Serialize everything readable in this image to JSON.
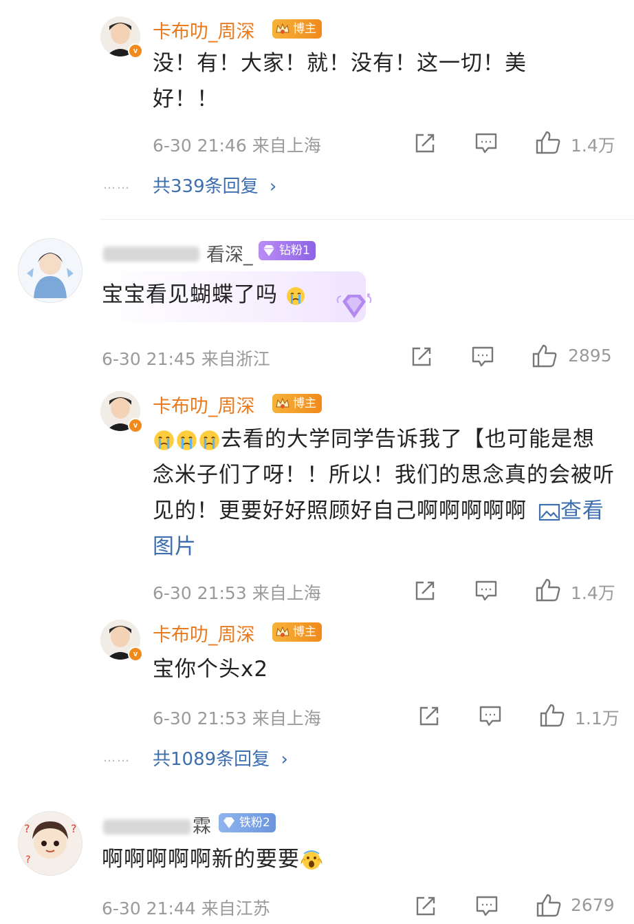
{
  "comments": [
    {
      "id": "c1",
      "username": "卡布叻_周深",
      "tag": "博主",
      "text": "没！有！大家！就！没有！这一切！美好！！",
      "time": "6-30 21:46",
      "location": "来自上海",
      "likes": "1.4万",
      "replies": "共339条回复"
    },
    {
      "id": "c2",
      "username_visible": "看深_",
      "tag": "钻粉1",
      "text": "宝宝看见蝴蝶了吗",
      "time": "6-30 21:45",
      "location": "来自浙江",
      "likes": "2895"
    },
    {
      "id": "c3",
      "username": "卡布叻_周深",
      "tag": "博主",
      "text": "去看的大学同学告诉我了【也可能是想念米子们了呀！！所以！我们的思念真的会被听见的！更要好好照顾好自己啊啊啊啊啊",
      "link": "查看图片",
      "time": "6-30 21:53",
      "location": "来自上海",
      "likes": "1.4万"
    },
    {
      "id": "c4",
      "username": "卡布叻_周深",
      "tag": "博主",
      "text": "宝你个头x2",
      "time": "6-30 21:53",
      "location": "来自上海",
      "likes": "1.1万",
      "replies": "共1089条回复"
    },
    {
      "id": "c5",
      "username_visible": "霖",
      "tag": "铁粉2",
      "text": "啊啊啊啊啊新的要要",
      "time": "6-30 21:44",
      "location": "来自江苏",
      "likes": "2679"
    }
  ],
  "ui": {
    "dots": "……",
    "chevron": "›",
    "vbadge": "v",
    "arrow_down": "⌄"
  },
  "colors": {
    "username": "#ea7a1e",
    "link": "#3d6fb0",
    "meta": "#9a9a9a",
    "blogger_tag": "#f08a1c",
    "diamond_tag": "#8d63e6",
    "iron_tag": "#6b94de"
  },
  "icons": [
    "share-icon",
    "comment-icon",
    "like-icon",
    "image-icon"
  ]
}
